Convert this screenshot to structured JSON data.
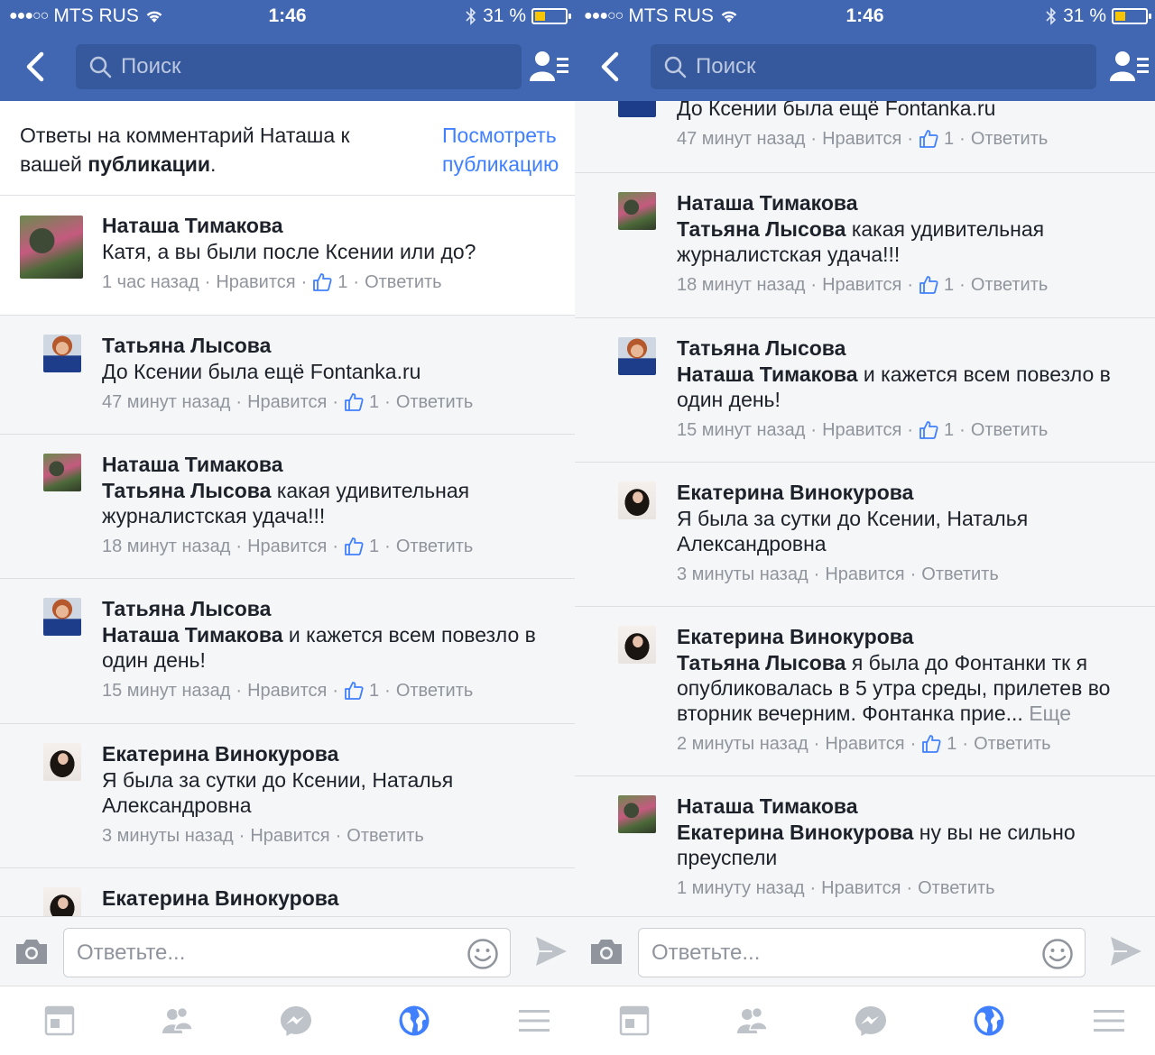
{
  "colors": {
    "brand": "#4267b2",
    "link": "#4080ff",
    "meta": "#90949c",
    "battery": "#f7c600",
    "active_tab": "#4080ff"
  },
  "status": {
    "carrier": "MTS RUS",
    "time": "1:46",
    "battery": "31 %"
  },
  "nav": {
    "search_placeholder": "Поиск"
  },
  "header": {
    "text_part1": "Ответы на комментарий Наташа к вашей ",
    "text_bold": "публикации",
    "text_end": ".",
    "link": "Посмотреть публикацию"
  },
  "common": {
    "like": "Нравится",
    "reply": "Ответить",
    "more": "Еще",
    "dot": "·"
  },
  "composer": {
    "placeholder": "Ответьте..."
  },
  "tabs": [
    "news-feed-icon",
    "friends-icon",
    "messenger-icon",
    "globe-notifications-icon",
    "menu-icon"
  ],
  "left": {
    "comments": [
      {
        "author": "Наташа Тимакова",
        "mention": "",
        "text": "Катя, а вы были после Ксении или до?",
        "time": "1 час назад",
        "likes": "1"
      },
      {
        "author": "Татьяна Лысова",
        "mention": "",
        "text": "До Ксении была ещё Fontanka.ru",
        "time": "47 минут назад",
        "likes": "1"
      },
      {
        "author": "Наташа Тимакова",
        "mention": "Татьяна Лысова",
        "text": "какая удивительная журналистская удача!!!",
        "time": "18 минут назад",
        "likes": "1"
      },
      {
        "author": "Татьяна Лысова",
        "mention": "Наташа Тимакова",
        "text": "и кажется всем повезло в один день!",
        "time": "15 минут назад",
        "likes": "1"
      },
      {
        "author": "Екатерина Винокурова",
        "mention": "",
        "text": "Я была за сутки до Ксении, Наталья Александровна",
        "time": "3 минуты назад",
        "likes": ""
      },
      {
        "author": "Екатерина Винокурова"
      }
    ]
  },
  "right": {
    "comments": [
      {
        "text": "До Ксении была ещё Fontanka.ru",
        "time": "47 минут назад",
        "likes": "1"
      },
      {
        "author": "Наташа Тимакова",
        "mention": "Татьяна Лысова",
        "text": "какая удивительная журналистская удача!!!",
        "time": "18 минут назад",
        "likes": "1"
      },
      {
        "author": "Татьяна Лысова",
        "mention": "Наташа Тимакова",
        "text": "и кажется всем повезло в один день!",
        "time": "15 минут назад",
        "likes": "1"
      },
      {
        "author": "Екатерина Винокурова",
        "mention": "",
        "text": "Я была за сутки до Ксении, Наталья Александровна",
        "time": "3 минуты назад",
        "likes": ""
      },
      {
        "author": "Екатерина Винокурова",
        "mention": "Татьяна Лысова",
        "text": "я была до Фонтанки тк я опубликовалась в 5 утра среды, прилетев во вторник вечерним. Фонтанка прие...",
        "time": "2 минуты назад",
        "likes": "1"
      },
      {
        "author": "Наташа Тимакова",
        "mention": "Екатерина Винокурова",
        "text": "ну вы не сильно преуспели",
        "time": "1 минуту назад",
        "likes": ""
      }
    ]
  }
}
